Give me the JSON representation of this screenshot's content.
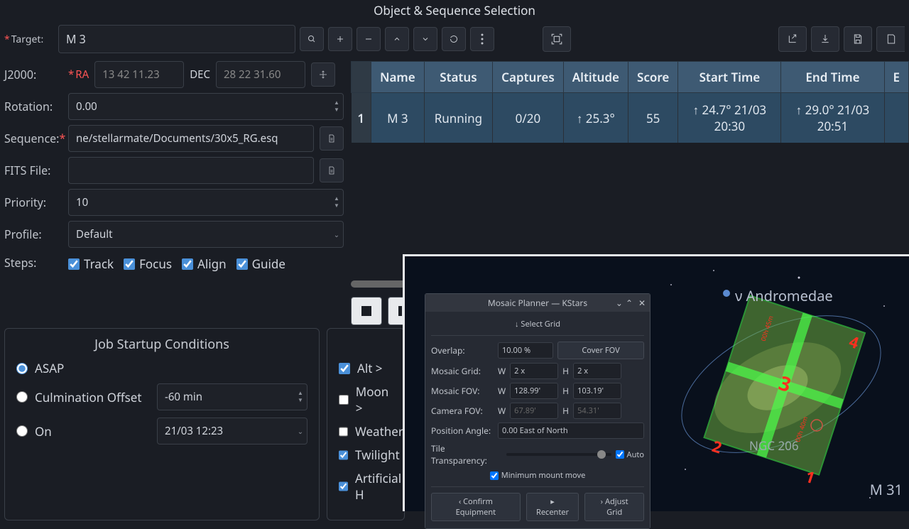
{
  "window_title": "Object & Sequence Selection",
  "target": {
    "label": "Target:",
    "value": "M 3"
  },
  "j2000": {
    "label": "J2000:",
    "ra_label": "RA",
    "ra_value": "13 42 11.23",
    "dec_label": "DEC",
    "dec_value": "28 22 31.60"
  },
  "rotation": {
    "label": "Rotation:",
    "value": "0.00"
  },
  "sequence": {
    "label": "Sequence:",
    "value": "ne/stellarmate/Documents/30x5_RG.esq"
  },
  "fits": {
    "label": "FITS File:",
    "value": ""
  },
  "priority": {
    "label": "Priority:",
    "value": "10"
  },
  "profile": {
    "label": "Profile:",
    "value": "Default"
  },
  "steps": {
    "label": "Steps:",
    "track": "Track",
    "focus": "Focus",
    "align": "Align",
    "guide": "Guide"
  },
  "table": {
    "headers": [
      "Name",
      "Status",
      "Captures",
      "Altitude",
      "Score",
      "Start Time",
      "End Time",
      "E"
    ],
    "row": {
      "num": "1",
      "name": "M 3",
      "status": "Running",
      "captures": "0/20",
      "altitude": "↑ 25.3°",
      "score": "55",
      "start": "↑ 24.7° 21/03 20:30",
      "end": "↑ 29.0° 21/03 20:51"
    }
  },
  "startup": {
    "title": "Job Startup Conditions",
    "asap": "ASAP",
    "culm": "Culmination Offset",
    "culm_val": "-60 min",
    "on": "On",
    "on_val": "21/03 12:23"
  },
  "constraints": {
    "alt": "Alt >",
    "moon": "Moon  >",
    "weather": "Weather",
    "twilight": "Twilight",
    "artificial": "Artificial H"
  },
  "mosaic": {
    "title": "Mosaic Planner — KStars",
    "select_grid": "Select Grid",
    "overlap_label": "Overlap:",
    "overlap_val": "10.00 %",
    "cover_fov": "Cover FOV",
    "grid_label": "Mosaic Grid:",
    "grid_w": "2 x",
    "grid_h": "2 x",
    "fov_label": "Mosaic FOV:",
    "fov_w": "128.99'",
    "fov_h": "103.19'",
    "cam_label": "Camera FOV:",
    "cam_w": "67.89'",
    "cam_h": "54.31'",
    "pa_label": "Position Angle:",
    "pa_val": "0.00 East of North",
    "transp_label": "Tile Transparency:",
    "auto": "Auto",
    "min_move": "Minimum mount move",
    "confirm": "Confirm Equipment",
    "recenter": "Recenter",
    "adjust": "Adjust Grid",
    "w": "W",
    "h": "H"
  },
  "sky": {
    "andromedae": "ν Andromedae",
    "ngc206": "NGC 206",
    "m31": "M 31",
    "center": "3"
  }
}
